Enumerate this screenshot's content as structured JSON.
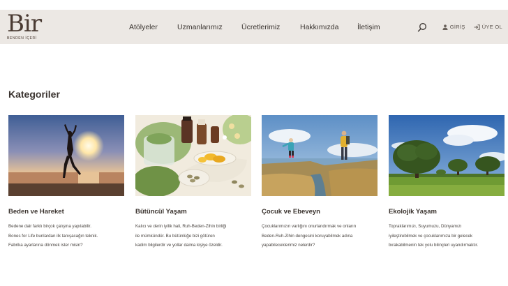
{
  "header": {
    "logo_main": "Bir",
    "logo_sub": "BENDEN İÇERİ",
    "nav": [
      {
        "label": "Atölyeler"
      },
      {
        "label": "Uzmanlarımız"
      },
      {
        "label": "Ücretlerimiz"
      },
      {
        "label": "Hakkımızda"
      },
      {
        "label": "İletişim"
      }
    ],
    "login_label": "GİRİŞ",
    "signup_label": "ÜYE OL"
  },
  "main": {
    "section_title": "Kategoriler",
    "cards": [
      {
        "title": "Beden ve Hareket",
        "desc_lines": [
          "Bedene dair farklı birçok çalışma yapılabilir.",
          "Bones for Life bunlardan ilk tanışacağın teknik.",
          "Fabrika ayarlarına dönmek ister misin?"
        ]
      },
      {
        "title": "Bütüncül Yaşam",
        "desc_lines": [
          "Kalıcı ve derin iyilik hali, Ruh-Beden-Zihin birliği",
          "ile mümkündür. Bu bütünlüğe bizi götüren",
          "kadim bilgilerdir ve yollar daima kişiye özeldir."
        ]
      },
      {
        "title": "Çocuk ve Ebeveyn",
        "desc_lines": [
          "Çocuklarımızın varlığını onurlandırmak ve onların",
          "Beden-Ruh-Zihin dengesini koruyabilmek adına",
          "yapabileceklerimiz nelerdir?"
        ]
      },
      {
        "title": "Ekolojik Yaşam",
        "desc_lines": [
          "Topraklarımızı, Suyumuzu, Dünyamızı",
          "iyileştirebilmek ve çocuklarımıza bir gelecek",
          "bırakabilmenin tek yolu bilinçleri uyandırmaktır."
        ]
      }
    ]
  },
  "colors": {
    "nav_bg": "#ece8e4",
    "brand_brown": "#4a3b33",
    "text_dark": "#3a332e"
  },
  "icons": [
    "search-icon",
    "user-icon",
    "sign-in-icon"
  ]
}
